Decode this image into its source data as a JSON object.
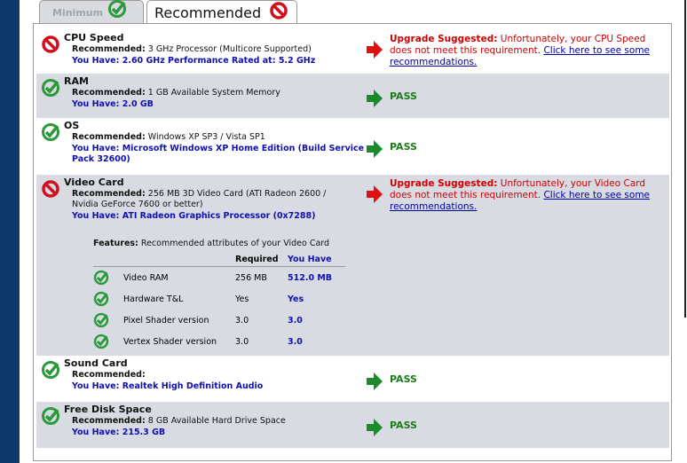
{
  "tabs": [
    {
      "label": "Minimum",
      "status": "pass"
    },
    {
      "label": "Recommended",
      "status": "fail"
    }
  ],
  "labels": {
    "recommended": "Recommended:",
    "you_have": "You Have:",
    "upgrade": "Upgrade Suggested:",
    "pass": "PASS",
    "link": "Click here to see some recommendations."
  },
  "items": [
    {
      "title": "CPU Speed",
      "status": "fail",
      "recommended": "3 GHz Processor (Multicore Supported)",
      "you_have": "2.60 GHz Performance Rated at: 5.2 GHz",
      "message": "Unfortunately, your CPU Speed does not meet this requirement."
    },
    {
      "title": "RAM",
      "status": "pass",
      "recommended": "1 GB Available System Memory",
      "you_have": "2.0 GB"
    },
    {
      "title": "OS",
      "status": "pass",
      "recommended": "Windows XP SP3 / Vista SP1",
      "you_have": "Microsoft Windows XP Home Edition (Build Service",
      "you_have_2": "Pack 32600)"
    },
    {
      "title": "Video Card",
      "status": "fail",
      "recommended": "256 MB 3D Video Card (ATI Radeon 2600 /",
      "recommended_2": "Nvidia GeForce 7600 or better)",
      "you_have": "ATI Radeon Graphics Processor (0x7288)",
      "message": "Unfortunately, your Video Card does not meet this requirement."
    },
    {
      "title": "Sound Card",
      "status": "pass",
      "recommended": "",
      "you_have": "Realtek High Definition Audio"
    },
    {
      "title": "Free Disk Space",
      "status": "pass",
      "recommended": "8 GB Available Hard Drive Space",
      "you_have": "215.3 GB"
    }
  ],
  "features": {
    "label": "Features:",
    "desc": "Recommended attributes of your Video Card",
    "col_required": "Required",
    "col_have": "You Have",
    "rows": [
      {
        "name": "Video RAM",
        "required": "256 MB",
        "have": "512.0 MB"
      },
      {
        "name": "Hardware T&L",
        "required": "Yes",
        "have": "Yes"
      },
      {
        "name": "Pixel Shader version",
        "required": "3.0",
        "have": "3.0"
      },
      {
        "name": "Vertex Shader version",
        "required": "3.0",
        "have": "3.0"
      }
    ]
  },
  "colors": {
    "pass": "#1a8a2a",
    "fail": "#d00000",
    "have": "#1010b0",
    "row_alt": "#d9dbe3"
  }
}
